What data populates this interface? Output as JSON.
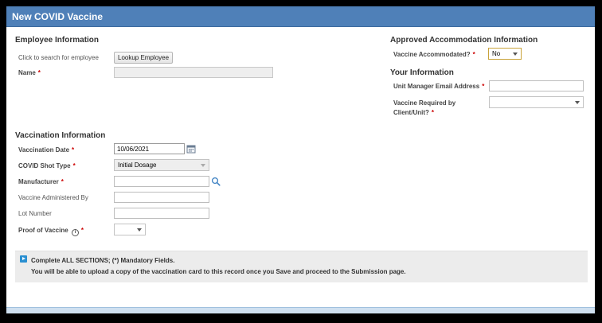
{
  "window": {
    "title": "New COVID Vaccine"
  },
  "employee": {
    "heading": "Employee Information",
    "search_hint": "Click to search for employee",
    "lookup_button": "Lookup Employee",
    "name_label": "Name",
    "name_value": ""
  },
  "accommodation": {
    "heading": "Approved Accommodation Information",
    "vaccine_accommodated_label": "Vaccine Accommodated?",
    "vaccine_accommodated_value": "No"
  },
  "your_info": {
    "heading": "Your Information",
    "manager_email_label": "Unit Manager Email Address",
    "manager_email_value": "",
    "vaccine_required_label_line1": "Vaccine Required by",
    "vaccine_required_label_line2": "Client/Unit?",
    "vaccine_required_value": ""
  },
  "vaccination": {
    "heading": "Vaccination Information",
    "date_label": "Vaccination Date",
    "date_value": "10/06/2021",
    "shot_type_label": "COVID Shot Type",
    "shot_type_value": "Initial Dosage",
    "manufacturer_label": "Manufacturer",
    "manufacturer_value": "",
    "administered_by_label": "Vaccine Administered By",
    "administered_by_value": "",
    "lot_number_label": "Lot Number",
    "lot_number_value": "",
    "proof_label": "Proof of Vaccine",
    "proof_value": ""
  },
  "required_marker": "*",
  "message": {
    "line1": "Complete ALL SECTIONS; (*) Mandatory Fields.",
    "line2": "You will be able to upload a copy of the vaccination card to this record once you Save and proceed to the Submission page."
  },
  "colors": {
    "titlebar": "#4f80b8",
    "required": "#cc0000",
    "info_icon": "#2a8fd1",
    "message_bg": "#ececec"
  },
  "icons": {
    "calendar": "calendar-icon",
    "search": "search-icon",
    "info": "info-icon",
    "help": "help-circle-icon"
  }
}
